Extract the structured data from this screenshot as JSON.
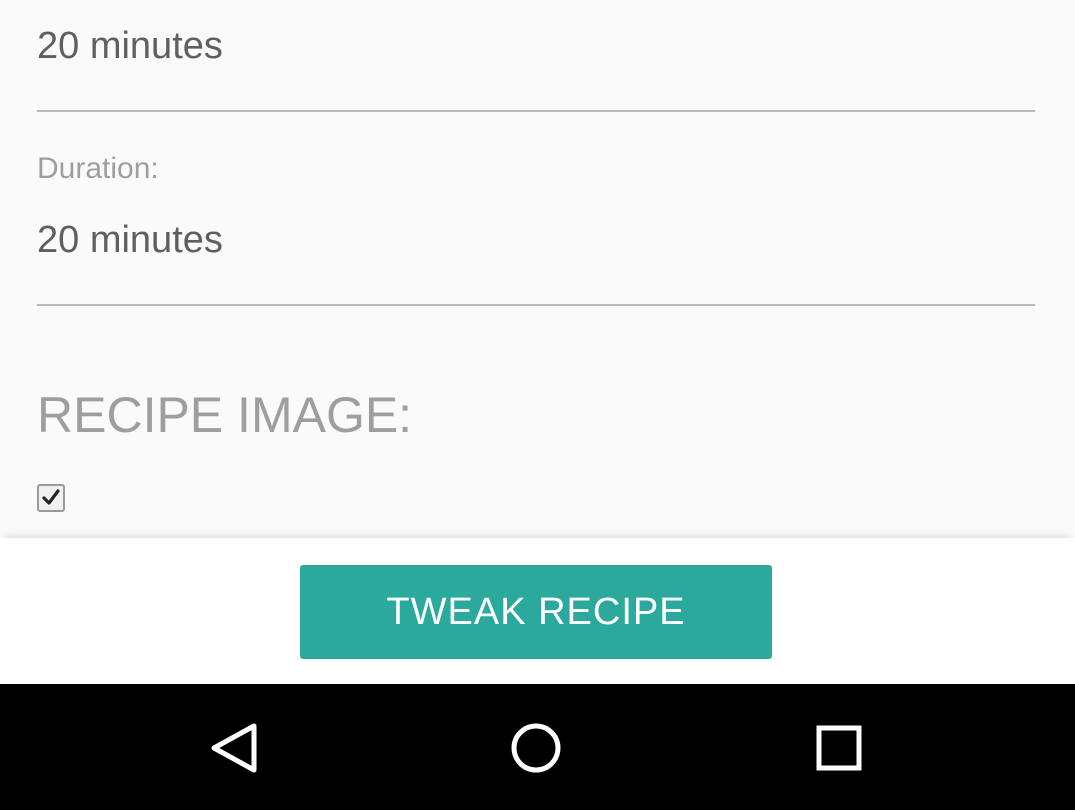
{
  "form": {
    "prep_time": {
      "value": "20 minutes"
    },
    "duration": {
      "label": "Duration:",
      "value": "20 minutes"
    },
    "recipe_image": {
      "title": "RECIPE IMAGE:",
      "checked": true
    }
  },
  "actions": {
    "tweak_label": "TWEAK RECIPE"
  },
  "navbar": {
    "back": "back-icon",
    "home": "home-icon",
    "recents": "recents-icon"
  },
  "colors": {
    "accent": "#2aa99c",
    "nav_bg": "#000000"
  }
}
